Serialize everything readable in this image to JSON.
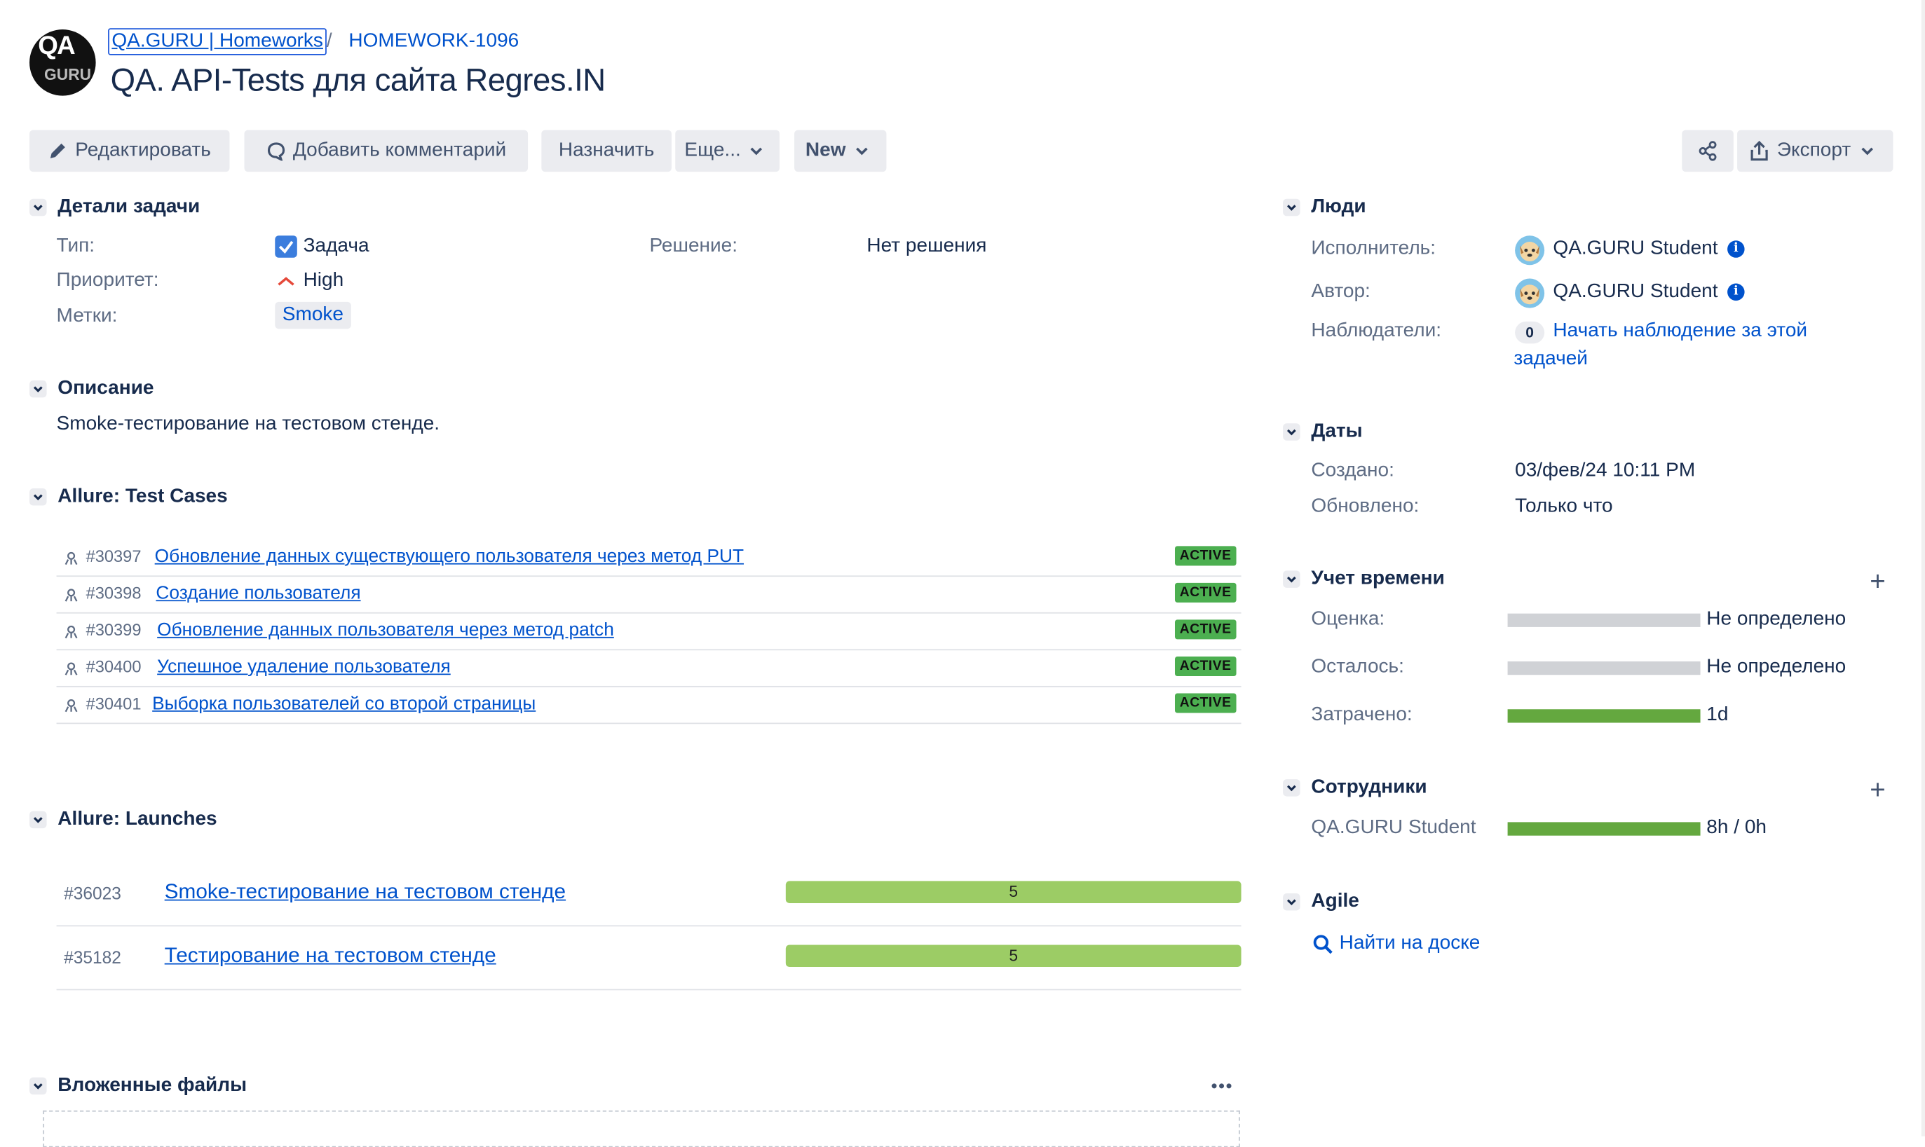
{
  "breadcrumb": {
    "project": "QA.GURU | Homeworks",
    "separator": "/",
    "issue_key": "HOMEWORK-1096"
  },
  "logo": {
    "line1": "QA",
    "line2": "GURU"
  },
  "issue": {
    "title": "QA. API-Tests для сайта Regres.IN"
  },
  "toolbar": {
    "edit": "Редактировать",
    "comment": "Добавить комментарий",
    "assign": "Назначить",
    "more": "Еще...",
    "status": "New",
    "export": "Экспорт"
  },
  "details": {
    "heading": "Детали задачи",
    "type_label": "Тип:",
    "type_value": "Задача",
    "resolution_label": "Решение:",
    "resolution_value": "Нет решения",
    "priority_label": "Приоритет:",
    "priority_value": "High",
    "labels_label": "Метки:",
    "labels_value": "Smoke"
  },
  "description": {
    "heading": "Описание",
    "text": "Smoke-тестирование на тестовом стенде."
  },
  "test_cases": {
    "heading": "Allure: Test Cases",
    "rows": [
      {
        "id": "#30397",
        "name": "Обновление данных существующего пользователя через метод PUT",
        "status": "ACTIVE"
      },
      {
        "id": "#30398",
        "name": "Создание пользователя",
        "status": "ACTIVE"
      },
      {
        "id": "#30399",
        "name": "Обновление данных пользователя через метод patch",
        "status": "ACTIVE"
      },
      {
        "id": "#30400",
        "name": "Успешное удаление пользователя",
        "status": "ACTIVE"
      },
      {
        "id": "#30401",
        "name": "Выборка пользователей со второй страницы",
        "status": "ACTIVE"
      }
    ]
  },
  "launches": {
    "heading": "Allure: Launches",
    "rows": [
      {
        "id": "#36023",
        "name": "Smoke-тестирование на тестовом стенде",
        "count": "5"
      },
      {
        "id": "#35182",
        "name": "Тестирование на тестовом стенде",
        "count": "5"
      }
    ]
  },
  "attachments": {
    "heading": "Вложенные файлы"
  },
  "people": {
    "heading": "Люди",
    "assignee_label": "Исполнитель:",
    "assignee": "QA.GURU Student",
    "reporter_label": "Автор:",
    "reporter": "QA.GURU Student",
    "watchers_label": "Наблюдатели:",
    "watchers_count": "0",
    "watch_link_line1": "Начать наблюдение за этой",
    "watch_link_line2": "задачей"
  },
  "dates": {
    "heading": "Даты",
    "created_label": "Создано:",
    "created": "03/фев/24 10:11 PM",
    "updated_label": "Обновлено:",
    "updated": "Только что"
  },
  "time_tracking": {
    "heading": "Учет времени",
    "estimate_label": "Оценка:",
    "estimate": "Не определено",
    "estimate_fill": 0,
    "remaining_label": "Осталось:",
    "remaining": "Не определено",
    "remaining_fill": 0,
    "logged_label": "Затрачено:",
    "logged": "1d",
    "logged_fill": 1.0
  },
  "staff": {
    "heading": "Сотрудники",
    "name": "QA.GURU Student",
    "value": "8h / 0h",
    "fill": 1.0
  },
  "agile": {
    "heading": "Agile",
    "link": "Найти на доске"
  },
  "colors": {
    "link": "#0052cc",
    "active_badge": "#4caf50",
    "launch_bar": "#9ccc65",
    "time_bar": "#64a83f"
  }
}
